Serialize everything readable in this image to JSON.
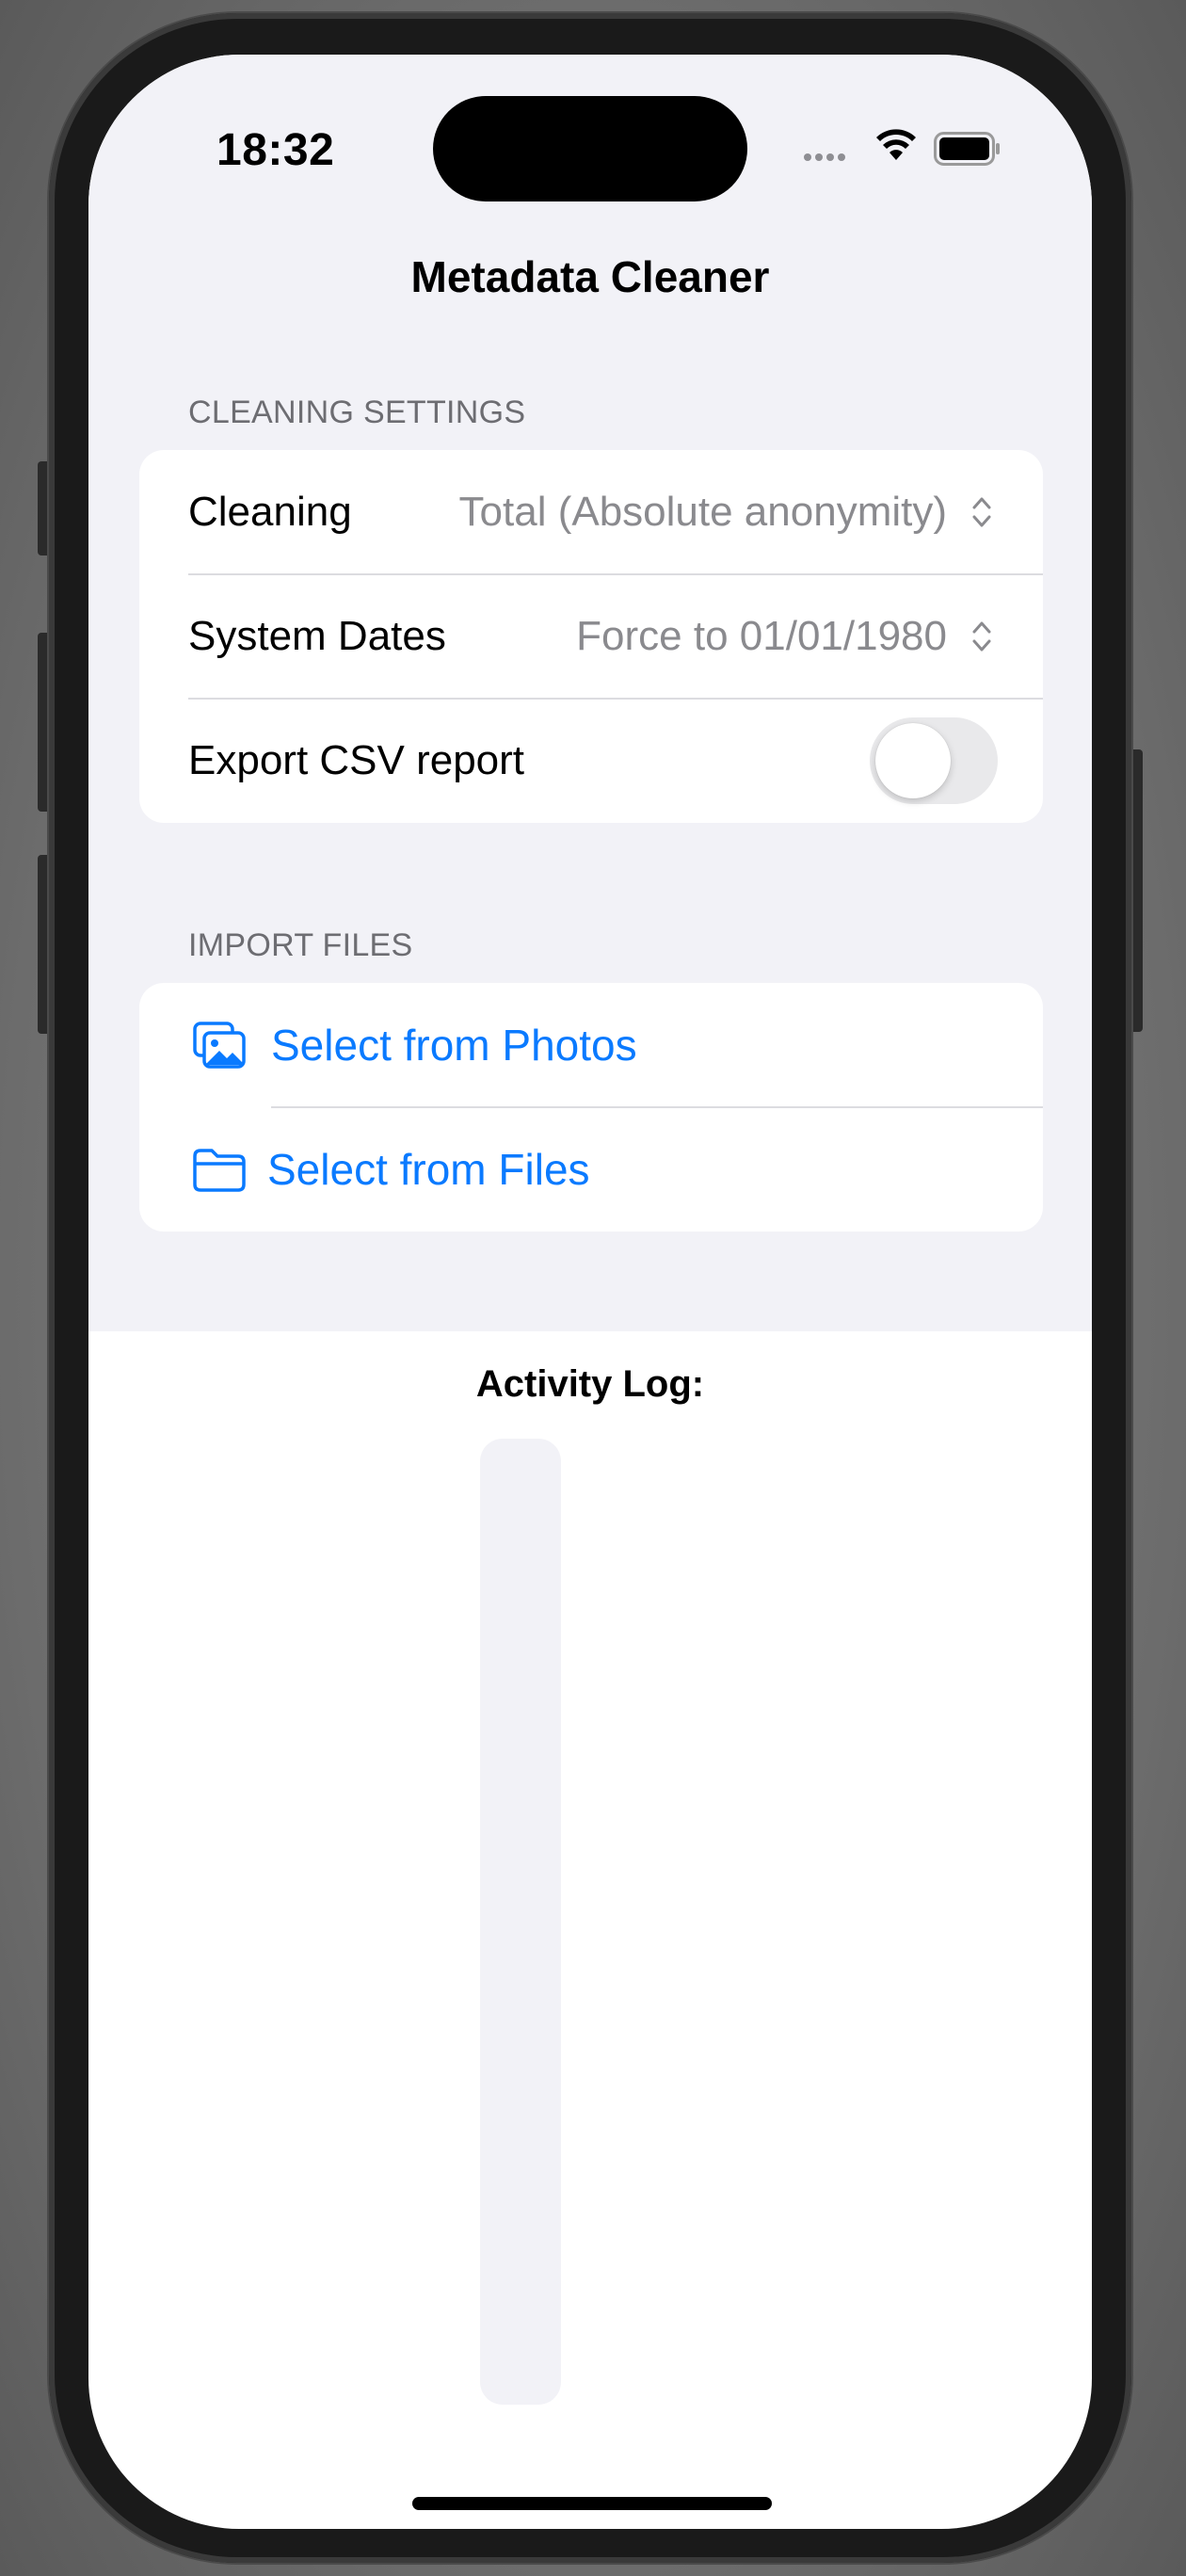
{
  "status_bar": {
    "time": "18:32"
  },
  "nav": {
    "title": "Metadata Cleaner"
  },
  "cleaning_settings": {
    "header": "CLEANING SETTINGS",
    "cleaning": {
      "label": "Cleaning",
      "value": "Total (Absolute anonymity)"
    },
    "system_dates": {
      "label": "System Dates",
      "value": "Force to 01/01/1980"
    },
    "export_csv": {
      "label": "Export CSV report",
      "enabled": false
    }
  },
  "import_files": {
    "header": "IMPORT FILES",
    "photos": {
      "label": "Select from Photos",
      "icon": "photos-icon"
    },
    "files": {
      "label": "Select from Files",
      "icon": "folder-icon"
    }
  },
  "activity_log": {
    "title": "Activity Log:"
  },
  "colors": {
    "accent": "#0a7aff",
    "grouped_background": "#f2f2f7",
    "secondary_text": "#8a8a8e",
    "toggle_off": "#e9e9eb"
  }
}
